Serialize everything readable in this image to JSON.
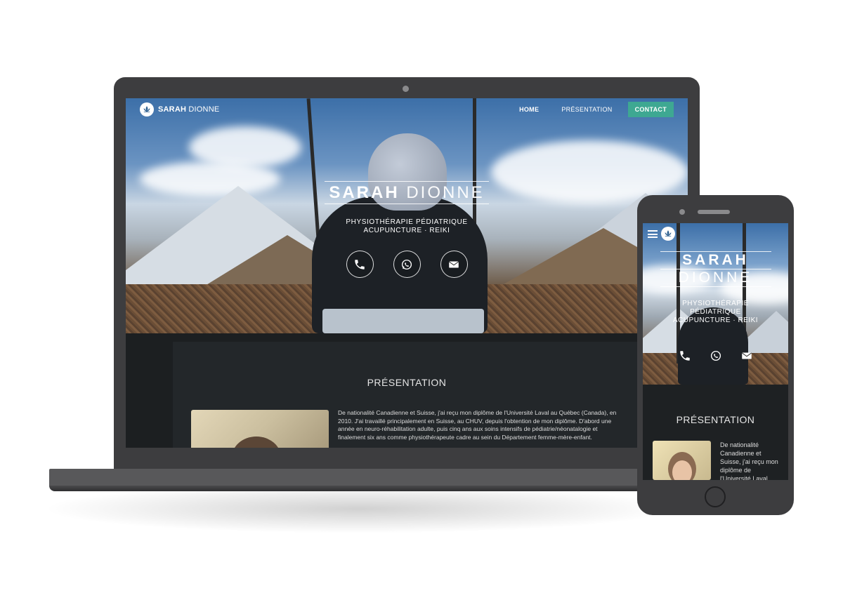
{
  "site": {
    "logo_bold": "SARAH",
    "logo_light": "DIONNE",
    "nav": {
      "home": "HOME",
      "presentation": "PRÉSENTATION",
      "contact": "CONTACT"
    },
    "hero": {
      "name_bold": "SARAH",
      "name_light": "DIONNE",
      "subtitle_line1": "PHYSIOTHÉRAPIE PÉDIATRIQUE",
      "subtitle_line2": "ACUPUNCTURE · REIKI",
      "icons": [
        "phone-icon",
        "whatsapp-icon",
        "mail-icon"
      ]
    },
    "presentation": {
      "title": "PRÉSENTATION",
      "text": "De nationalité Canadienne et Suisse, j'ai reçu mon diplôme de l'Université Laval au Québec (Canada), en 2010. J'ai travaillé principalement en Suisse, au CHUV, depuis l'obtention de mon diplôme. D'abord une année en neuro-réhabilitation adulte, puis cinq ans aux soins intensifs de pédiatrie/néonatalogie et finalement six ans comme physiothérapeute cadre au sein du Département femme-mère-enfant."
    }
  },
  "phone": {
    "hero": {
      "name_line1": "SARAH",
      "name_line2": "DIONNE",
      "subtitle_line1": "PHYSIOTHÉRAPIE",
      "subtitle_line2": "PÉDIATRIQUE",
      "subtitle_line3": "ACUPUNCTURE · REIKI"
    },
    "presentation": {
      "title": "PRÉSENTATION",
      "text": "De nationalité Canadienne et Suisse, j'ai reçu mon diplôme de l'Université Laval"
    }
  },
  "colors": {
    "accent": "#3ea892",
    "device_frame": "#3d3d3f",
    "section_bg": "#1c1f21"
  }
}
